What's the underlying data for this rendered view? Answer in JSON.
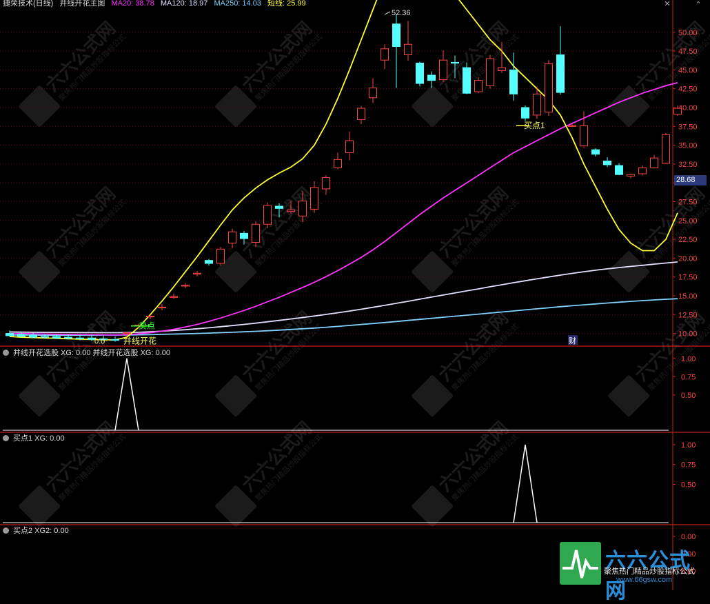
{
  "main_header": {
    "title": "捷荣技术(日线)",
    "indicator_name": "并线开花主图",
    "items": [
      {
        "text": "MA20: 38.78",
        "color": "#ff33ff"
      },
      {
        "text": "MA120: 18.97",
        "color": "#e0e0ff"
      },
      {
        "text": "MA250: 14.03",
        "color": "#7fd2ff"
      },
      {
        "text": "短线: 25.99",
        "color": "#ffff33"
      }
    ]
  },
  "panel2_header": {
    "label": "并线开花选股 XG: 0.00 并线开花选股 XG: 0.00"
  },
  "panel3_header": {
    "label": "买点1 XG: 0.00"
  },
  "panel4_header": {
    "label": "买点2 XG2: 0.00"
  },
  "current_price_tag": "28.68",
  "annotations": {
    "high_label": "52.36",
    "sell_label": "卖点",
    "buy_label": "买点1",
    "open_label": "并线开花",
    "small_num": "0.0",
    "fin_label": "财"
  },
  "logo": {
    "brand": "六六公式网",
    "slogan": "聚焦热门精品炒股指标公式",
    "url": "www.66gsw.com",
    "watermark_text": "六六公式网",
    "watermark_sub": "聚焦热门精品炒股指标公式"
  },
  "colors": {
    "up": "#ff4444",
    "down": "#54ffff",
    "ma20": "#ff33ff",
    "ma120": "#e0e0ff",
    "ma250": "#7fd2ff",
    "short": "#ffff33",
    "axis": "#c81e1e",
    "grid": "#7a0a0a",
    "text_axis": "#ff4444"
  },
  "chart_data": [
    {
      "type": "candlestick",
      "title": "并线开花主图",
      "ylim": [
        8.5,
        53
      ],
      "y_ticks": [
        10.0,
        12.5,
        15.0,
        17.5,
        20.0,
        22.5,
        25.0,
        27.5,
        30.0,
        32.5,
        35.0,
        37.5,
        40.0,
        42.5,
        45.0,
        47.5,
        50.0
      ],
      "y_tick_labels": [
        "10.00",
        "12.50",
        "15.00",
        "17.50",
        "20.00",
        "22.50",
        "25.00",
        "27.50",
        "30.00",
        "32.50",
        "35.00",
        "37.50",
        "40.00",
        "42.50",
        "45.00",
        "47.50",
        "50.00"
      ],
      "candles": [
        {
          "o": 10.0,
          "h": 10.4,
          "l": 9.6,
          "c": 9.7
        },
        {
          "o": 9.9,
          "h": 10.2,
          "l": 9.5,
          "c": 9.6
        },
        {
          "o": 9.8,
          "h": 10.1,
          "l": 9.4,
          "c": 9.5
        },
        {
          "o": 9.6,
          "h": 9.9,
          "l": 9.3,
          "c": 9.5
        },
        {
          "o": 9.6,
          "h": 9.9,
          "l": 9.3,
          "c": 9.4
        },
        {
          "o": 9.5,
          "h": 9.9,
          "l": 9.2,
          "c": 9.4
        },
        {
          "o": 9.4,
          "h": 9.8,
          "l": 9.1,
          "c": 9.3
        },
        {
          "o": 9.4,
          "h": 9.8,
          "l": 9.0,
          "c": 9.2
        },
        {
          "o": 9.3,
          "h": 9.7,
          "l": 9.0,
          "c": 9.2
        },
        {
          "o": 9.2,
          "h": 9.6,
          "l": 8.9,
          "c": 9.1
        },
        {
          "o": 10.0,
          "h": 10.2,
          "l": 9.6,
          "c": 10.1
        },
        {
          "o": 11.0,
          "h": 11.3,
          "l": 10.7,
          "c": 11.1
        },
        {
          "o": 12.2,
          "h": 12.5,
          "l": 11.9,
          "c": 12.3
        },
        {
          "o": 13.4,
          "h": 13.9,
          "l": 13.1,
          "c": 13.5
        },
        {
          "o": 14.8,
          "h": 15.3,
          "l": 14.6,
          "c": 14.9
        },
        {
          "o": 16.3,
          "h": 16.7,
          "l": 16.0,
          "c": 16.4
        },
        {
          "o": 17.9,
          "h": 18.3,
          "l": 17.6,
          "c": 18.0
        },
        {
          "o": 19.7,
          "h": 19.9,
          "l": 19.0,
          "c": 19.3
        },
        {
          "o": 19.3,
          "h": 21.5,
          "l": 19.0,
          "c": 21.2
        },
        {
          "o": 22.0,
          "h": 23.9,
          "l": 21.3,
          "c": 23.5
        },
        {
          "o": 23.3,
          "h": 23.6,
          "l": 21.8,
          "c": 22.6
        },
        {
          "o": 22.1,
          "h": 24.9,
          "l": 21.5,
          "c": 24.5
        },
        {
          "o": 24.5,
          "h": 27.4,
          "l": 24.0,
          "c": 27.0
        },
        {
          "o": 26.9,
          "h": 27.3,
          "l": 25.4,
          "c": 26.6
        },
        {
          "o": 26.2,
          "h": 27.6,
          "l": 25.9,
          "c": 26.4
        },
        {
          "o": 25.6,
          "h": 28.9,
          "l": 24.8,
          "c": 27.6
        },
        {
          "o": 26.5,
          "h": 30.2,
          "l": 26.0,
          "c": 29.4
        },
        {
          "o": 29.2,
          "h": 31.0,
          "l": 28.4,
          "c": 30.7
        },
        {
          "o": 32.0,
          "h": 34.0,
          "l": 31.8,
          "c": 33.1
        },
        {
          "o": 34.0,
          "h": 36.8,
          "l": 33.0,
          "c": 35.6
        },
        {
          "o": 38.4,
          "h": 40.2,
          "l": 37.8,
          "c": 39.9
        },
        {
          "o": 41.3,
          "h": 43.9,
          "l": 40.6,
          "c": 42.6
        },
        {
          "o": 46.3,
          "h": 48.4,
          "l": 45.1,
          "c": 47.8
        },
        {
          "o": 51.1,
          "h": 52.4,
          "l": 42.6,
          "c": 48.1
        },
        {
          "o": 47.0,
          "h": 51.5,
          "l": 46.2,
          "c": 48.4
        },
        {
          "o": 45.9,
          "h": 46.1,
          "l": 42.8,
          "c": 43.2
        },
        {
          "o": 44.3,
          "h": 44.8,
          "l": 42.6,
          "c": 43.6
        },
        {
          "o": 43.7,
          "h": 47.6,
          "l": 43.4,
          "c": 46.3
        },
        {
          "o": 46.0,
          "h": 46.9,
          "l": 43.9,
          "c": 45.9
        },
        {
          "o": 45.3,
          "h": 46.0,
          "l": 41.8,
          "c": 41.9
        },
        {
          "o": 42.1,
          "h": 44.0,
          "l": 41.9,
          "c": 43.6
        },
        {
          "o": 42.9,
          "h": 47.0,
          "l": 42.5,
          "c": 46.5
        },
        {
          "o": 44.9,
          "h": 48.7,
          "l": 44.6,
          "c": 45.3
        },
        {
          "o": 45.0,
          "h": 47.3,
          "l": 40.9,
          "c": 41.8
        },
        {
          "o": 40.0,
          "h": 40.3,
          "l": 38.2,
          "c": 38.6
        },
        {
          "o": 39.0,
          "h": 42.8,
          "l": 38.5,
          "c": 41.8
        },
        {
          "o": 39.4,
          "h": 46.3,
          "l": 38.9,
          "c": 45.8
        },
        {
          "o": 47.0,
          "h": 50.8,
          "l": 41.7,
          "c": 42.0
        },
        {
          "o": 37.6,
          "h": 37.8,
          "l": 37.5,
          "c": 37.6
        },
        {
          "o": 34.9,
          "h": 39.5,
          "l": 34.7,
          "c": 37.6
        },
        {
          "o": 34.4,
          "h": 34.6,
          "l": 33.5,
          "c": 33.8
        },
        {
          "o": 32.9,
          "h": 33.4,
          "l": 32.1,
          "c": 32.4
        },
        {
          "o": 32.3,
          "h": 32.6,
          "l": 31.0,
          "c": 31.1
        },
        {
          "o": 30.9,
          "h": 31.2,
          "l": 30.6,
          "c": 31.1
        },
        {
          "o": 31.2,
          "h": 32.3,
          "l": 31.0,
          "c": 32.0
        },
        {
          "o": 32.0,
          "h": 33.7,
          "l": 31.9,
          "c": 33.3
        },
        {
          "o": 32.6,
          "h": 36.6,
          "l": 32.5,
          "c": 36.4
        },
        {
          "o": 39.1,
          "h": 40.3,
          "l": 38.9,
          "c": 39.9
        }
      ],
      "series": [
        {
          "name": "MA20",
          "color": "#ff33ff",
          "values": [
            10.0,
            9.98,
            9.95,
            9.93,
            9.9,
            9.88,
            9.86,
            9.84,
            9.82,
            9.8,
            9.85,
            9.95,
            10.1,
            10.3,
            10.55,
            10.85,
            11.2,
            11.6,
            12.05,
            12.55,
            13.05,
            13.6,
            14.2,
            14.8,
            15.45,
            16.1,
            16.8,
            17.55,
            18.35,
            19.2,
            20.1,
            21.1,
            22.2,
            23.4,
            24.6,
            25.8,
            26.9,
            28.0,
            29.0,
            30.0,
            31.0,
            32.0,
            33.0,
            34.0,
            34.8,
            35.6,
            36.4,
            37.2,
            37.9,
            38.6,
            39.3,
            40.0,
            40.7,
            41.3,
            41.9,
            42.4,
            42.9,
            43.3
          ]
        },
        {
          "name": "MA120",
          "color": "#e0e0ff",
          "values": [
            10.2,
            10.18,
            10.16,
            10.15,
            10.14,
            10.13,
            10.12,
            10.11,
            10.1,
            10.1,
            10.12,
            10.16,
            10.22,
            10.3,
            10.4,
            10.5,
            10.62,
            10.75,
            10.9,
            11.05,
            11.2,
            11.37,
            11.55,
            11.73,
            11.92,
            12.12,
            12.32,
            12.53,
            12.75,
            12.98,
            13.22,
            13.47,
            13.73,
            14.0,
            14.27,
            14.55,
            14.83,
            15.1,
            15.38,
            15.65,
            15.92,
            16.2,
            16.47,
            16.74,
            17.0,
            17.25,
            17.5,
            17.75,
            17.98,
            18.2,
            18.4,
            18.58,
            18.75,
            18.9,
            19.05,
            19.2,
            19.35,
            19.5
          ]
        },
        {
          "name": "MA250",
          "color": "#7fd2ff",
          "values": [
            9.8,
            9.79,
            9.78,
            9.77,
            9.77,
            9.77,
            9.77,
            9.77,
            9.78,
            9.78,
            9.8,
            9.82,
            9.85,
            9.88,
            9.92,
            9.96,
            10.0,
            10.05,
            10.1,
            10.16,
            10.22,
            10.29,
            10.36,
            10.44,
            10.53,
            10.62,
            10.72,
            10.83,
            10.94,
            11.06,
            11.19,
            11.32,
            11.45,
            11.59,
            11.73,
            11.87,
            12.01,
            12.15,
            12.29,
            12.43,
            12.57,
            12.71,
            12.85,
            12.99,
            13.13,
            13.27,
            13.41,
            13.55,
            13.68,
            13.8,
            13.92,
            14.04,
            14.15,
            14.26,
            14.36,
            14.45,
            14.54,
            14.62
          ]
        },
        {
          "name": "短线",
          "color": "#ffff33",
          "values": [
            9.6,
            9.5,
            9.45,
            9.4,
            9.35,
            9.3,
            9.25,
            9.2,
            9.15,
            9.15,
            9.5,
            10.8,
            12.5,
            14.3,
            16.2,
            18.2,
            20.2,
            22.3,
            24.4,
            26.4,
            28.0,
            29.3,
            30.4,
            31.3,
            32.1,
            33.2,
            35.0,
            37.8,
            41.2,
            45.0,
            49.0,
            53.0,
            57.0,
            60.0,
            61.0,
            60.5,
            59.0,
            57.0,
            55.0,
            53.0,
            51.0,
            49.0,
            47.5,
            45.5,
            44.0,
            42.5,
            41.0,
            39.0,
            36.0,
            32.5,
            29.5,
            26.5,
            23.8,
            22.0,
            21.0,
            21.0,
            22.5,
            26.0
          ]
        }
      ],
      "annotations": [
        "52.36",
        "卖点",
        "买点1",
        "并线开花",
        "0.0",
        "财"
      ]
    },
    {
      "type": "line",
      "title": "并线开花选股",
      "ylim": [
        0,
        1.13
      ],
      "y_ticks": [
        0.5,
        0.75,
        1.0
      ],
      "y_tick_labels": [
        "0.50",
        "0.75",
        "1.00"
      ],
      "spike_index": 10,
      "values": [
        0,
        0,
        0,
        0,
        0,
        0,
        0,
        0,
        0,
        0,
        1,
        0,
        0,
        0,
        0,
        0,
        0,
        0,
        0,
        0,
        0,
        0,
        0,
        0,
        0,
        0,
        0,
        0,
        0,
        0,
        0,
        0,
        0,
        0,
        0,
        0,
        0,
        0,
        0,
        0,
        0,
        0,
        0,
        0,
        0,
        0,
        0,
        0,
        0,
        0,
        0,
        0,
        0,
        0,
        0,
        0,
        0,
        0
      ]
    },
    {
      "type": "line",
      "title": "买点1",
      "ylim": [
        0,
        1.13
      ],
      "y_ticks": [
        0.5,
        0.75,
        1.0
      ],
      "y_tick_labels": [
        "0.50",
        "0.75",
        "1.00"
      ],
      "spike_index": 44,
      "values": [
        0,
        0,
        0,
        0,
        0,
        0,
        0,
        0,
        0,
        0,
        0,
        0,
        0,
        0,
        0,
        0,
        0,
        0,
        0,
        0,
        0,
        0,
        0,
        0,
        0,
        0,
        0,
        0,
        0,
        0,
        0,
        0,
        0,
        0,
        0,
        0,
        0,
        0,
        0,
        0,
        0,
        0,
        0,
        0,
        1,
        0,
        0,
        0,
        0,
        0,
        0,
        0,
        0,
        0,
        0,
        0,
        0,
        0
      ]
    },
    {
      "type": "line",
      "title": "买点2",
      "ylim": [
        0,
        1.13
      ],
      "y_ticks": [
        0.0,
        0.0,
        0.0
      ],
      "y_tick_labels": [
        "0.00",
        "0.00",
        "0.00"
      ],
      "values": []
    }
  ]
}
